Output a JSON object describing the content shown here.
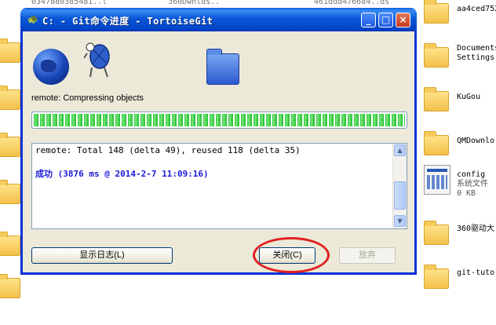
{
  "desktop": {
    "right_items": [
      {
        "label": "aa4ced752"
      },
      {
        "label": "Documents\nSettings"
      },
      {
        "label": "KuGou"
      },
      {
        "label": "QMDownlo"
      },
      {
        "label": "config",
        "type": "系统文件",
        "size": "0 KB"
      },
      {
        "label": "360驱动大"
      },
      {
        "label": "git-tuto"
      }
    ],
    "top_partial_labels": [
      "0347880385481..l",
      "360Dwnlds..",
      "461ddd476684..ds"
    ]
  },
  "window": {
    "title": "C: - Git命令进度 - TortoiseGit",
    "controls": {
      "minimize": "_",
      "maximize": "□",
      "close": "×"
    },
    "status_text": "remote: Compressing objects",
    "progress_fraction": 1.0,
    "log": {
      "lines": [
        {
          "text": "remote: Total 148 (delta 49), reused 118 (delta 35)",
          "color": "#000000"
        },
        {
          "text": "成功 (3876 ms @ 2014-2-7 11:09:16)",
          "color": "#1a1ad6"
        }
      ]
    },
    "buttons": {
      "show_log": "显示日志(L)",
      "close": "关闭(C)",
      "abort": "放弃"
    }
  },
  "colors": {
    "title_bar": "#0a56d6",
    "progress": "#2fc43a",
    "highlight": "#e02020"
  }
}
